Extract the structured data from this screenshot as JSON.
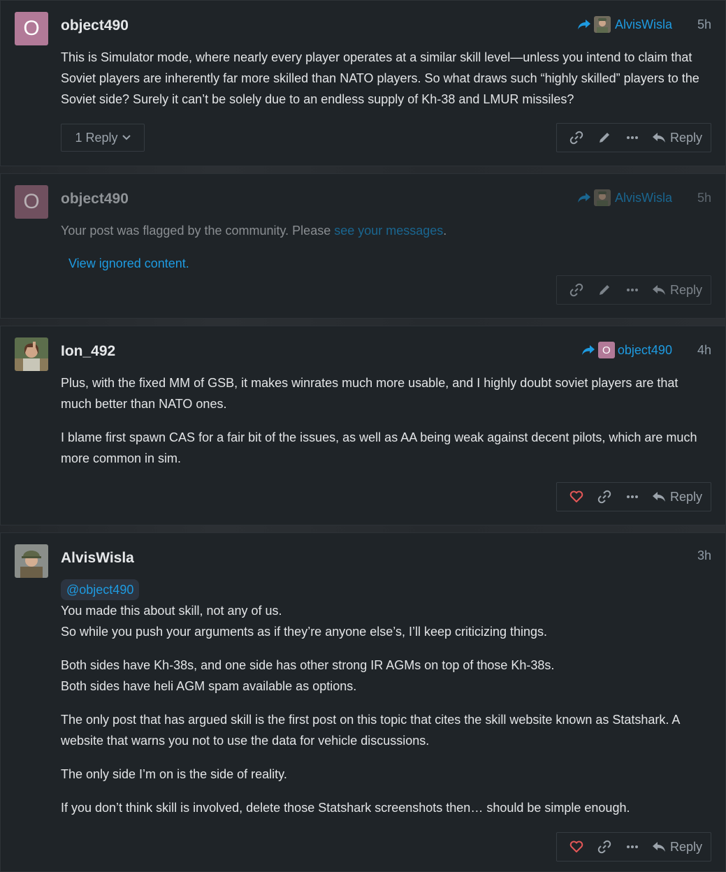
{
  "posts": [
    {
      "author": "object490",
      "avatar_letter": "O",
      "reply_to": "AlvisWisla",
      "time": "5h",
      "paragraphs": [
        "This is Simulator mode, where nearly every player operates at a similar skill level—unless you intend to claim that Soviet players are inherently far more skilled than NATO players. So what draws such “highly skilled” players to the Soviet side? Surely it can’t be solely due to an endless supply of Kh-38 and LMUR missiles?"
      ],
      "replies_label": "1 Reply",
      "reply_label": "Reply"
    },
    {
      "author": "object490",
      "avatar_letter": "O",
      "reply_to": "AlvisWisla",
      "time": "5h",
      "flag_text": "Your post was flagged by the community. Please ",
      "flag_link": "see your messages",
      "flag_end": ".",
      "ignored_link": "View ignored content.",
      "reply_label": "Reply"
    },
    {
      "author": "Ion_492",
      "reply_to": "object490",
      "reply_to_letter": "O",
      "time": "4h",
      "paragraphs": [
        "Plus, with the fixed MM of GSB, it makes winrates much more usable, and I highly doubt soviet players are that much better than NATO ones.",
        "I blame first spawn CAS for a fair bit of the issues, as well as AA being weak against decent pilots, which are much more common in sim."
      ],
      "reply_label": "Reply"
    },
    {
      "author": "AlvisWisla",
      "time": "3h",
      "mention": "@object490",
      "lines": [
        "You made this about skill, not any of us.",
        "So while you push your arguments as if they’re anyone else’s, I’ll keep criticizing things."
      ],
      "lines2": [
        "Both sides have Kh-38s, and one side has other strong IR AGMs on top of those Kh-38s.",
        "Both sides have heli AGM spam available as options."
      ],
      "paragraphs": [
        "The only post that has argued skill is the first post on this topic that cites the skill website known as Statshark. A website that warns you not to use the data for vehicle discussions.",
        "The only side I’m on is the side of reality.",
        "If you don’t think skill is involved, delete those Statshark screenshots then… should be simple enough."
      ],
      "reply_label": "Reply"
    }
  ],
  "colors": {
    "background": "#1f2428",
    "link": "#1e9be1",
    "heart": "#e45757",
    "avatar_letter_bg": "#b27a98"
  },
  "icons": [
    "share-icon",
    "link-icon",
    "pencil-icon",
    "ellipsis-icon",
    "reply-icon",
    "heart-icon",
    "chevron-down-icon"
  ]
}
